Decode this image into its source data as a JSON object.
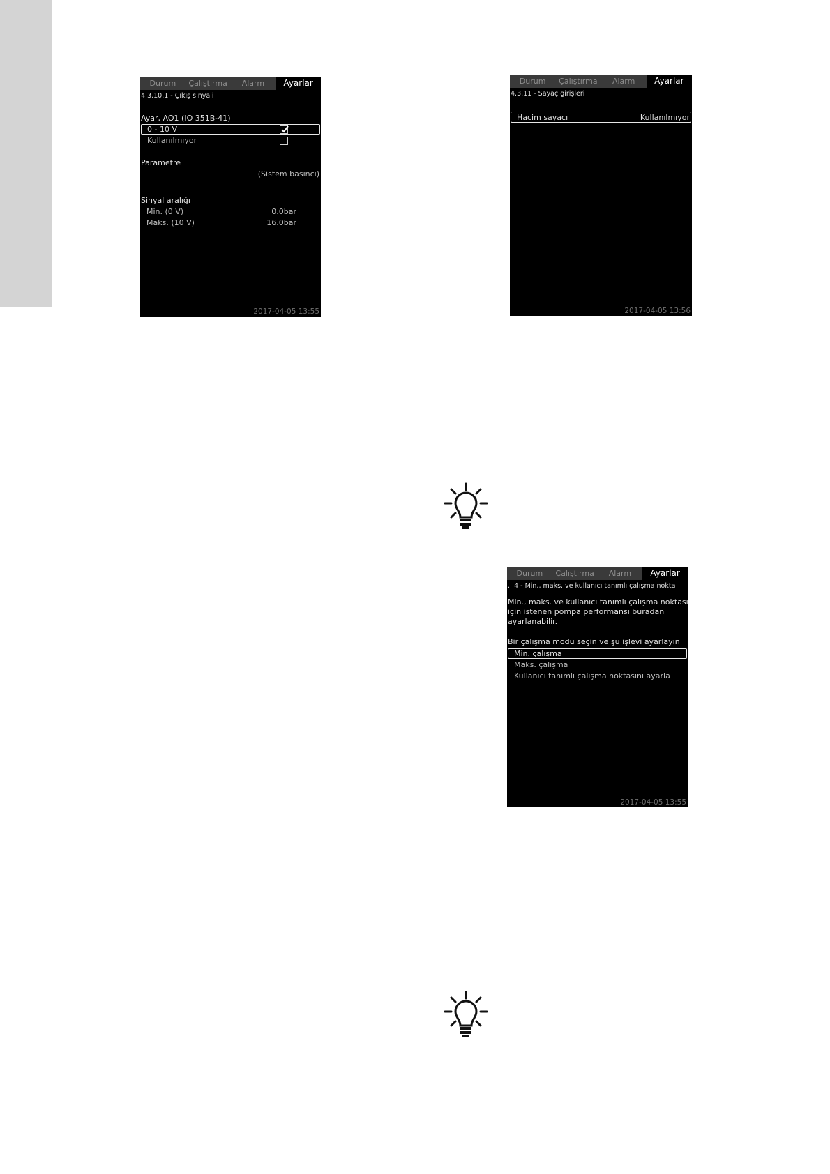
{
  "tabs": [
    "Durum",
    "Çalıştırma",
    "Alarm",
    "Ayarlar"
  ],
  "screen1": {
    "title": "4.3.10.1 - Çıkış sinyali",
    "setting_header": "Ayar, AO1 (IO 351B-41)",
    "options": [
      {
        "label": "0 - 10 V",
        "checked": true
      },
      {
        "label": "Kullanılmıyor",
        "checked": false
      }
    ],
    "param_header": "Parametre",
    "param_value": "(Sistem basıncı)",
    "range_header": "Sinyal aralığı",
    "min_label": "Min. (0 V)",
    "min_value": "0.0bar",
    "max_label": "Maks. (10 V)",
    "max_value": "16.0bar",
    "timestamp": "2017-04-05 13:55"
  },
  "screen2": {
    "title": "4.3.11 - Sayaç girişleri",
    "item_label": "Hacim sayacı",
    "item_value": "Kullanılmıyor",
    "timestamp": "2017-04-05 13:56"
  },
  "screen3": {
    "title": "...4 - Min., maks. ve kullanıcı tanımlı çalışma nokta",
    "desc_line1": "Min., maks. ve kullanıcı tanımlı çalışma noktası",
    "desc_line2": "için istenen pompa performansı buradan",
    "desc_line3": "ayarlanabilir.",
    "instruction": "Bir çalışma modu seçin ve şu işlevi ayarlayın",
    "options": [
      "Min. çalışma",
      "Maks. çalışma",
      "Kullanıcı tanımlı çalışma noktasını ayarla"
    ],
    "timestamp": "2017-04-05 13:55"
  },
  "icons": [
    "lightbulb-icon",
    "lightbulb-icon"
  ]
}
